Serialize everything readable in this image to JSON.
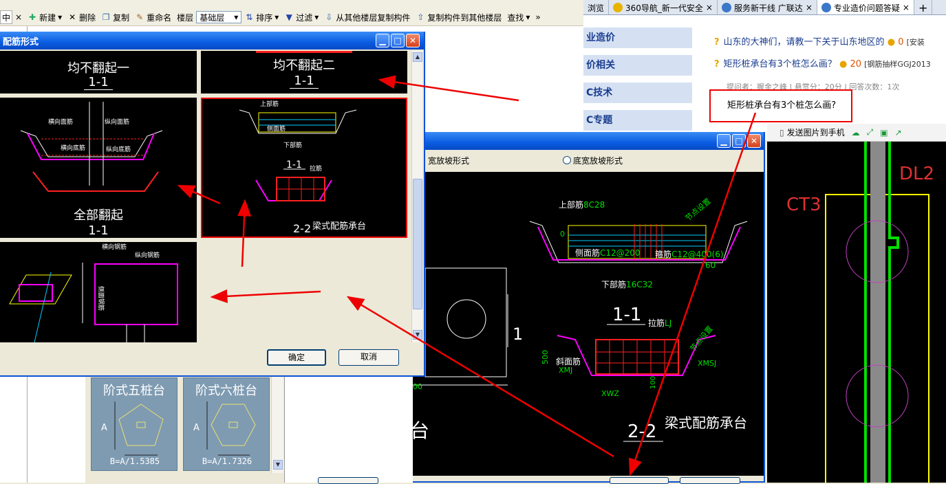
{
  "toolbar": {
    "items": [
      "新建",
      "删除",
      "复制",
      "重命名",
      "楼层"
    ],
    "floor_value": "基础层",
    "items2": [
      "排序",
      "过滤",
      "从其他楼层复制构件",
      "复制构件到其他楼层",
      "查找"
    ],
    "left_btn": "中",
    "left_close": "×",
    "overflow": "»"
  },
  "browser": {
    "tabs": [
      "浏览",
      "360导航_新一代安全",
      "服务新干线 广联达",
      "专业造价问题答疑"
    ],
    "close": "×",
    "new_tab": "+"
  },
  "website": {
    "nav": [
      "业造价",
      "价相关",
      "C技术",
      "C专题"
    ],
    "questions": [
      {
        "text": "山东的大神们，请教一下关于山东地区的",
        "score": "0",
        "tag": "[安装"
      },
      {
        "text": "矩形桩承台有3个桩怎么画？",
        "score": "20",
        "tag": "[钢筋抽样GGJ2013"
      }
    ],
    "meta": [
      "提问者：握金之峰",
      "悬赏分：20分",
      "回答次数：1次"
    ],
    "send_label": "发送图片到手机",
    "callout": "矩形桩承台有3个桩怎么画?"
  },
  "cad": {
    "label1": "DL2",
    "label2": "CT3"
  },
  "dialog_front": {
    "title": "配筋形式",
    "cells": [
      {
        "name": "均不翻起一",
        "sub": "1-1"
      },
      {
        "name": "均不翻起二",
        "sub": "1-1"
      },
      {
        "name": "全部翻起",
        "sub": "1-1"
      },
      {
        "name": "梁式配筋承台",
        "sub1": "1-1",
        "sub2": "2-2"
      }
    ],
    "labels": {
      "top_bar": "上部筋",
      "side_bar": "侧面筋",
      "bottom_bar": "下部筋",
      "tie_bar": "拉筋",
      "h_bar": "横向面筋",
      "v_bar": "纵向面筋",
      "h_bottom": "横向底筋",
      "v_bottom": "纵向底筋",
      "h_steel": "横向钢筋",
      "v_steel": "纵向钢筋",
      "side_steel": "侧面钢筋"
    },
    "ok": "确定",
    "cancel": "取消"
  },
  "dialog_back": {
    "radio1": "宽放坡形式",
    "radio2": "底宽放坡形式",
    "title_main": "矩形承台",
    "num1": "1",
    "num2": "2",
    "dim1500": "1500",
    "sec11": "1-1",
    "sec22": "2-2",
    "beam_label": "梁式配筋承台",
    "top": "上部筋",
    "top_v": "8C28",
    "side": "侧面筋",
    "side_v": "C12@200",
    "stir": "箍筋",
    "stir_v": "C12@400(6)",
    "bottom": "下部筋",
    "bottom_v": "16C32",
    "tie": "拉筋",
    "tie_v": "LJ",
    "slope": "斜面筋",
    "slope_v": "XMJ",
    "xmsj": "XMSJ",
    "xwz": "XWZ",
    "d500": "500",
    "d60": "60",
    "d100": "100",
    "d0": "0",
    "rebar_note": "节点设置"
  },
  "pile_cards": [
    {
      "title": "阶式五桩台",
      "formula": "B=A/1.5385",
      "a": "A"
    },
    {
      "title": "阶式六桩台",
      "formula": "B=A/1.7326",
      "a": "A"
    }
  ],
  "colors": {
    "accent": "#0a5ce2",
    "highlight": "#ff0000",
    "cad_green": "#00e000",
    "cad_yellow": "#ffff00",
    "cad_magenta": "#ff00ff"
  }
}
